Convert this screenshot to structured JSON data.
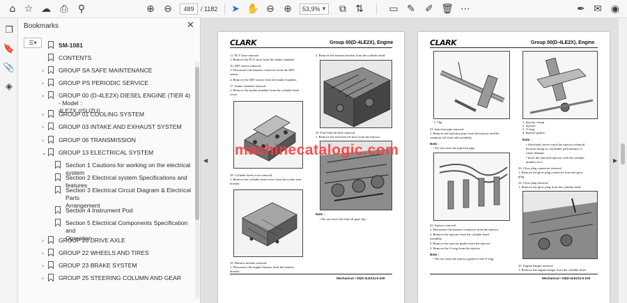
{
  "toolbar": {
    "page_current": "489",
    "page_total": "/ 1182",
    "zoom": "53,9%"
  },
  "bookmarks": {
    "title": "Bookmarks",
    "options_label": "☰▾",
    "items": [
      {
        "label": "SM-1081",
        "expandable": false,
        "bold": true
      },
      {
        "label": "CONTENTS",
        "expandable": false
      },
      {
        "label": "GROUP SA SAFE MAINTENANCE",
        "expandable": true
      },
      {
        "label": "GROUP PS PERIODIC SERVICE",
        "expandable": true
      },
      {
        "label": "GROUP 00 (D-4LE2X) DIESEL ENGINE (TIER 4) - Model :",
        "label2": "4LE2X (ISUZU)",
        "expandable": true
      },
      {
        "label": "GROUP 01 COOLING SYSTEM",
        "expandable": true
      },
      {
        "label": "GROUP 03 INTAKE AND EXHAUST SYSTEM",
        "expandable": true
      },
      {
        "label": "GROUP 06 TRANSMISSION",
        "expandable": true
      },
      {
        "label": "GROUP 13 ELECTRICAL SYSTEM",
        "expandable": true,
        "expanded": true
      },
      {
        "label": "Section 1 Cautions for working on the electrical system",
        "sub": true
      },
      {
        "label": "Section 2 Electrical system Specifications and features",
        "sub": true
      },
      {
        "label": "Section 3 Electrical Circuit Diagram & Electrical Parts",
        "label2": "Arrangement",
        "sub": true
      },
      {
        "label": "Section 4 Instrument Pod",
        "sub": true
      },
      {
        "label": "Section 5 Electrical Components Specification and",
        "label2": "Operation",
        "sub": true
      },
      {
        "label": "GROUP 20 DRIVE AXLE",
        "expandable": true
      },
      {
        "label": "GROUP 22 WHEELS AND TIRES",
        "expandable": true
      },
      {
        "label": "GROUP 23 BRAKE SYSTEM",
        "expandable": true
      },
      {
        "label": "GROUP 25 STEERING COLUMN AND GEAR",
        "expandable": true
      }
    ]
  },
  "watermark": "machinecatalogic.com",
  "left_page": {
    "logo": "CLARK",
    "header": "Group 00(D-4LE2X), Engine",
    "col1": [
      "11.  PCV hose  removal",
      "       1.  Remove the PCV hose from the intake chamber.",
      "16.  IMT sensor  removal",
      "       1.  Disconnect the harness connector from the IMT",
      "            sensor.",
      "       2.  Remove the IMT sensor from the intake chamber.",
      "17.  Intake chamber  removal",
      "       1.  Remove the intake chamber from the cylinder head",
      "            cover."
    ],
    "col1b": [
      "18.  Cylinder head cover  removal",
      "       1.  Remove the cylinder head cover from the rocker arm",
      "            bracket."
    ],
    "col1c": [
      "19.  Harness bracket  removal",
      "       1.  Disconnect the engine harness from the harness",
      "            bracket."
    ],
    "col2": [
      "2.  Remove the harness bracket from the cylinder head."
    ],
    "col2b": [
      "20.  Fuel leak-off hose  removal",
      "       1.  Remove the fuel leak-off hose from the injector."
    ],
    "note_label": "Note :",
    "note": "•   Do not reuse the leak-off pipe clip.",
    "footer": "Mechanical • 00(D-4LE2X)-6-229"
  },
  "right_page": {
    "logo": "CLARK",
    "header": "Group 00(D-4LE2X), Engine",
    "fig1_caption": "1.  Clip",
    "col1": [
      "21.  Injection pipe  removal",
      "       1.  Remove the injection pipe from the injector and the",
      "            common rail (fuel rail) assembly."
    ],
    "note1_label": "Note :",
    "note1": "•   Do not reuse the injection pipe.",
    "col1b": [
      "22.  Injector  removal",
      "       1.  Disconnect the harness connector from the injector.",
      "       2.  Remove the injector from the cylinder head",
      "            assembly.",
      "       3.  Remove the injector gasket from the injector.",
      "       4.  Remove the O-ring from the injector."
    ],
    "note2_label": "Note :",
    "note2": "•   Do not reuse the injector gasket or the O-ring.",
    "col2": [
      "1.  Injector clamp",
      "2.  Injector",
      "3.  O-ring",
      "4.  Injector gasket"
    ],
    "note3_label": "Note :",
    "col2b": [
      "•   Absolutely never touch the injector solenoid",
      "     because doing so can hinder performance or",
      "     cause damage.",
      "•   Store the removed injector with the cylinder",
      "     number on it.",
      "23.  Glow plug connector  removal",
      "       1.  Remove the glow plug connector from the glow",
      "            plug.",
      "24.  Glow plug  removal",
      "       1.  Remove the glow plug from the cylinder head."
    ],
    "col2c": [
      "25.  Engine hanger  removal",
      "       1.  Remove the engine hanger from the cylinder head."
    ],
    "footer": "Mechanical • 00(D-4LE2X)-6-229"
  }
}
